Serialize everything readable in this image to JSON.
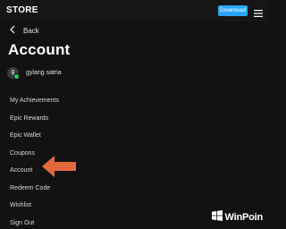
{
  "topbar": {
    "logo": "STORE",
    "download_label": "Download",
    "menu_icon": "hamburger-icon"
  },
  "back": {
    "icon": "chevron-left-icon",
    "label": "Back"
  },
  "page": {
    "title": "Account"
  },
  "user": {
    "avatar_initial": "g",
    "name": "gylang satria",
    "status_color": "#3fc35a"
  },
  "menu": {
    "items": [
      {
        "label": "My Achievements"
      },
      {
        "label": "Epic Rewards"
      },
      {
        "label": "Epic Wallet"
      },
      {
        "label": "Coupons"
      },
      {
        "label": "Account"
      },
      {
        "label": "Redeem Code"
      },
      {
        "label": "Wishlist"
      },
      {
        "label": "Sign Out"
      }
    ]
  },
  "annotation": {
    "icon": "arrow-left-icon",
    "color": "#e2693e"
  },
  "watermark": {
    "text": "WinPoin",
    "icon": "windows-logo-icon"
  },
  "colors": {
    "background": "#121212",
    "accent": "#2aa6f5"
  }
}
